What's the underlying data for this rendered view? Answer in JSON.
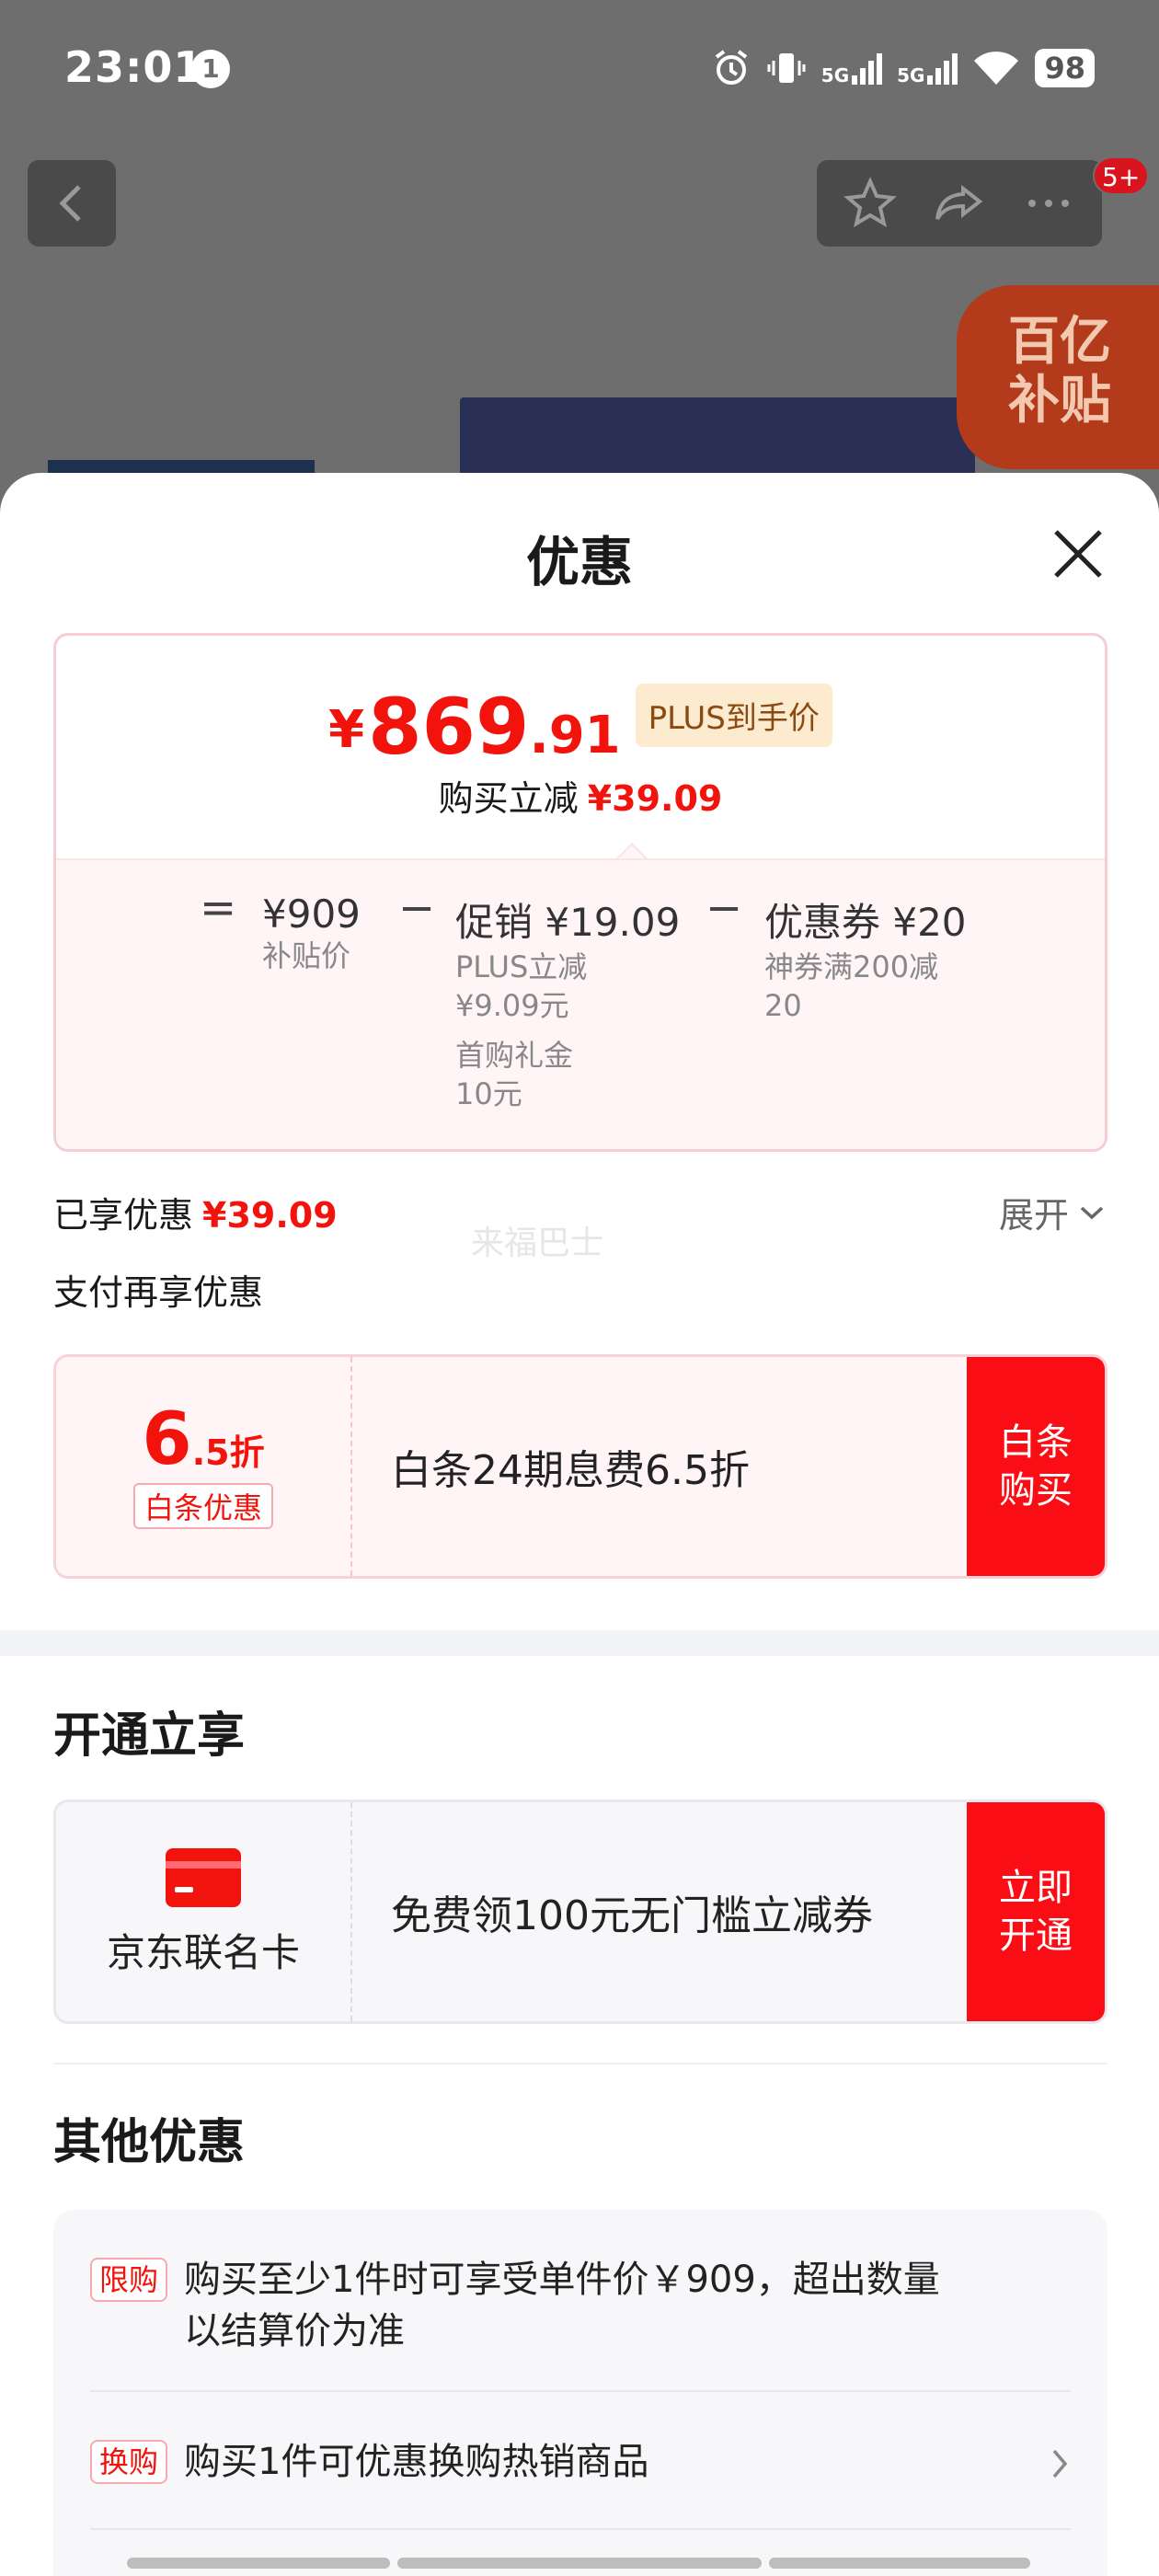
{
  "status_bar": {
    "time": "23:01",
    "notification_count": "1",
    "network_1": "5G",
    "network_2": "5G",
    "battery": "98"
  },
  "nav": {
    "cart_badge": "5+"
  },
  "subsidy_badge": {
    "line1": "百亿",
    "line2": "补贴"
  },
  "sheet": {
    "title": "优惠",
    "price": {
      "currency": "¥",
      "integer": "869",
      "decimal": ".91",
      "tag": "PLUS到手价",
      "save_label": "购买立减",
      "save_amount": "¥39.09"
    },
    "breakdown": {
      "eq": "=",
      "minus": "−",
      "base_value": "¥909",
      "base_label": "补贴价",
      "promo_value": "促销 ¥19.09",
      "promo_detail_1": "PLUS立减",
      "promo_detail_2": "¥9.09元",
      "promo_detail_3": "首购礼金",
      "promo_detail_4": "10元",
      "coupon_value": "优惠券 ¥20",
      "coupon_detail_1": "神券满200减",
      "coupon_detail_2": "20"
    },
    "enjoyed_label": "已享优惠",
    "enjoyed_amount": "¥39.09",
    "watermark": "来福巴士",
    "expand_label": "展开",
    "pay_section_title": "支付再享优惠",
    "pay_card": {
      "discount_int": "6",
      "discount_dec": ".5折",
      "tag": "白条优惠",
      "desc": "白条24期息费6.5折",
      "cta_line1": "白条",
      "cta_line2": "购买"
    },
    "open_section_title": "开通立享",
    "jd_card": {
      "label": "京东联名卡",
      "desc": "免费领100元无门槛立减券",
      "cta_line1": "立即",
      "cta_line2": "开通"
    },
    "other_section_title": "其他优惠",
    "other": [
      {
        "tag": "限购",
        "line1": "购买至少1件时可享受单件价￥909，超出数量",
        "line2": "以结算价为准"
      },
      {
        "tag": "换购",
        "line1": "购买1件可优惠换购热销商品"
      }
    ]
  },
  "colors": {
    "accent_red": "#f2140c",
    "cta_red": "#fa0d14"
  }
}
